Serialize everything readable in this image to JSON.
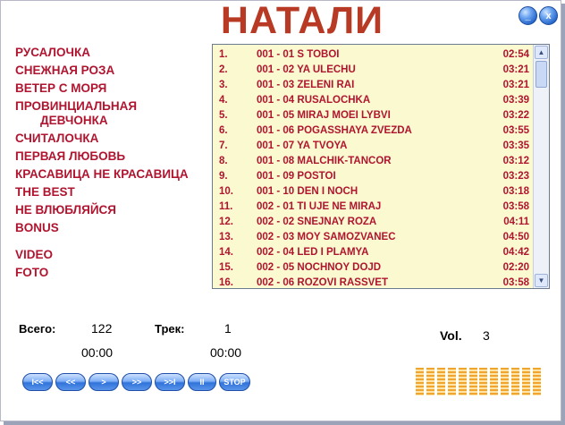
{
  "app": {
    "title": "НАТАЛИ"
  },
  "window_controls": {
    "minimize": "_",
    "close": "x"
  },
  "menu": {
    "items": [
      "РУСАЛОЧКА",
      "СНЕЖНАЯ РОЗА",
      "ВЕТЕР С МОРЯ",
      "ПРОВИНЦИАЛЬНАЯ",
      "ДЕВЧОНКА",
      "СЧИТАЛОЧКА",
      "ПЕРВАЯ ЛЮБОВЬ",
      "КРАСАВИЦА НЕ КРАСАВИЦА",
      "THE BEST",
      "НЕ ВЛЮБЛЯЙСЯ",
      "BONUS"
    ],
    "media": [
      "VIDEO",
      "FOTO"
    ]
  },
  "playlist": [
    {
      "num": "1.",
      "name": "001 - 01 S TOBOI",
      "dur": "02:54"
    },
    {
      "num": "2.",
      "name": "001 - 02 YA ULECHU",
      "dur": "03:21"
    },
    {
      "num": "3.",
      "name": "001 - 03 ZELENI RAI",
      "dur": "03:21"
    },
    {
      "num": "4.",
      "name": "001 - 04 RUSALOCHKA",
      "dur": "03:39"
    },
    {
      "num": "5.",
      "name": "001 - 05 MIRAJ MOEI LYBVI",
      "dur": "03:22"
    },
    {
      "num": "6.",
      "name": "001 - 06 POGASSHAYA ZVEZDA",
      "dur": "03:55"
    },
    {
      "num": "7.",
      "name": "001 - 07 YA TVOYA",
      "dur": "03:35"
    },
    {
      "num": "8.",
      "name": "001 - 08 MALCHIK-TANCOR",
      "dur": "03:12"
    },
    {
      "num": "9.",
      "name": "001 - 09 POSTOI",
      "dur": "03:23"
    },
    {
      "num": "10.",
      "name": "001 - 10 DEN I NOCH",
      "dur": "03:18"
    },
    {
      "num": "11.",
      "name": "002 - 01 TI UJE NE MIRAJ",
      "dur": "03:58"
    },
    {
      "num": "12.",
      "name": "002 - 02 SNEJNAY ROZA",
      "dur": "04:11"
    },
    {
      "num": "13.",
      "name": "002 - 03 MOY SAMOZVANEC",
      "dur": "04:50"
    },
    {
      "num": "14.",
      "name": "002 - 04 LED I PLAMYA",
      "dur": "04:42"
    },
    {
      "num": "15.",
      "name": "002 - 05 NOCHNOY DOJD",
      "dur": "02:20"
    },
    {
      "num": "16.",
      "name": "002 - 06 ROZOVI RASSVET",
      "dur": "03:58"
    }
  ],
  "stats": {
    "total_label": "Всего:",
    "total_value": "122",
    "track_label": "Трек:",
    "track_value": "1",
    "time_total": "00:00",
    "time_track": "00:00"
  },
  "volume": {
    "label": "Vol.",
    "value": "3"
  },
  "controls": {
    "first": "I<<",
    "rewind": "<<",
    "play": ">",
    "forward": ">>",
    "last": ">>I",
    "pause": "II",
    "stop": "STOP"
  },
  "colors": {
    "title": "#b83a24",
    "menu_text": "#b01530",
    "playlist_bg": "#fbf9cf",
    "button_blue": "#2f72da",
    "volume_bar": "#f0a62e"
  },
  "icons": {
    "scroll_up": "▲",
    "scroll_down": "▼"
  }
}
